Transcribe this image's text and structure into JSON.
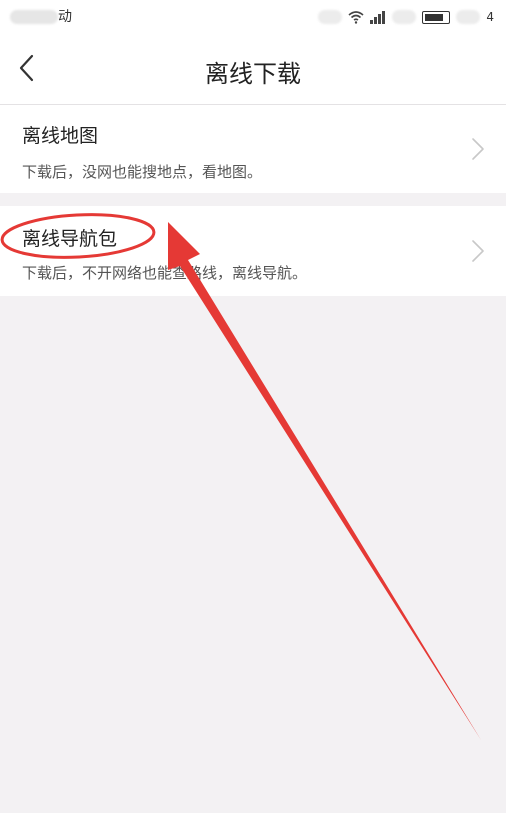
{
  "status_bar": {
    "carrier_suffix": "动",
    "battery_suffix": "4"
  },
  "nav": {
    "title": "离线下载",
    "back_icon": "chevron-left-icon"
  },
  "items": [
    {
      "title": "离线地图",
      "description": "下载后，没网也能搜地点，看地图。",
      "chevron_icon": "chevron-right-icon"
    },
    {
      "title": "离线导航包",
      "description": "下载后，不开网络也能查路线，离线导航。",
      "chevron_icon": "chevron-right-icon"
    }
  ],
  "annotation": {
    "color": "#e53935"
  },
  "colors": {
    "background": "#f3f1f3",
    "surface": "#ffffff",
    "title_text": "#222222",
    "secondary_text": "#555555",
    "chevron": "#c8c8c8"
  }
}
